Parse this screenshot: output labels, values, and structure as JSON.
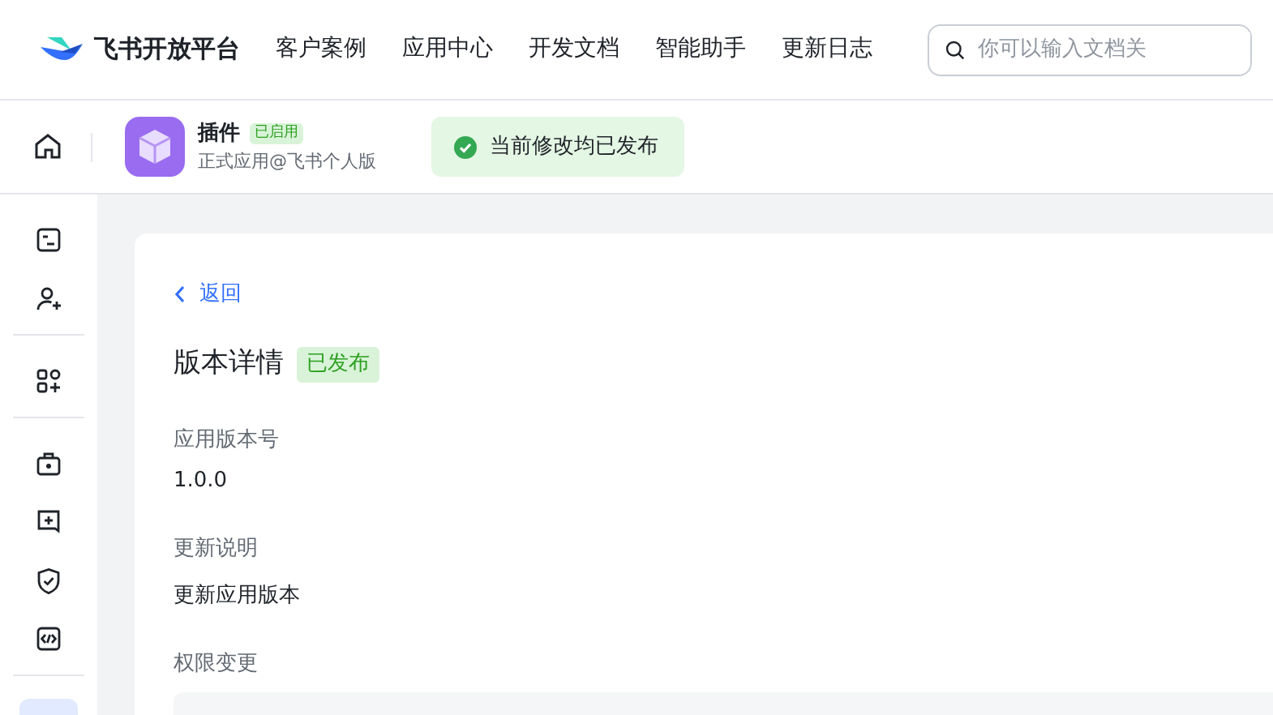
{
  "brand": {
    "title": "飞书开放平台"
  },
  "nav": [
    {
      "label": "客户案例"
    },
    {
      "label": "应用中心"
    },
    {
      "label": "开发文档"
    },
    {
      "label": "智能助手"
    },
    {
      "label": "更新日志"
    }
  ],
  "search": {
    "placeholder": "你可以输入文档关"
  },
  "app": {
    "name": "插件",
    "status": "已启用",
    "subtitle": "正式应用@飞书个人版"
  },
  "publish_notice": {
    "text": "当前修改均已发布"
  },
  "sidebar": {
    "groups": [
      [
        {
          "kind": "terminal",
          "selected": false
        },
        {
          "kind": "user-add",
          "selected": false
        }
      ],
      [
        {
          "kind": "apps",
          "selected": false
        }
      ],
      [
        {
          "kind": "bag",
          "selected": false
        },
        {
          "kind": "plus-box",
          "selected": false
        },
        {
          "kind": "shield",
          "selected": false
        },
        {
          "kind": "code",
          "selected": false
        }
      ],
      [
        {
          "kind": "blank",
          "selected": true
        }
      ]
    ]
  },
  "detail": {
    "back": "返回",
    "title": "版本详情",
    "status": "已发布",
    "fields": [
      {
        "label": "应用版本号",
        "value": "1.0.0"
      },
      {
        "label": "更新说明",
        "value": "更新应用版本"
      }
    ],
    "permissions_label": "权限变更"
  }
}
